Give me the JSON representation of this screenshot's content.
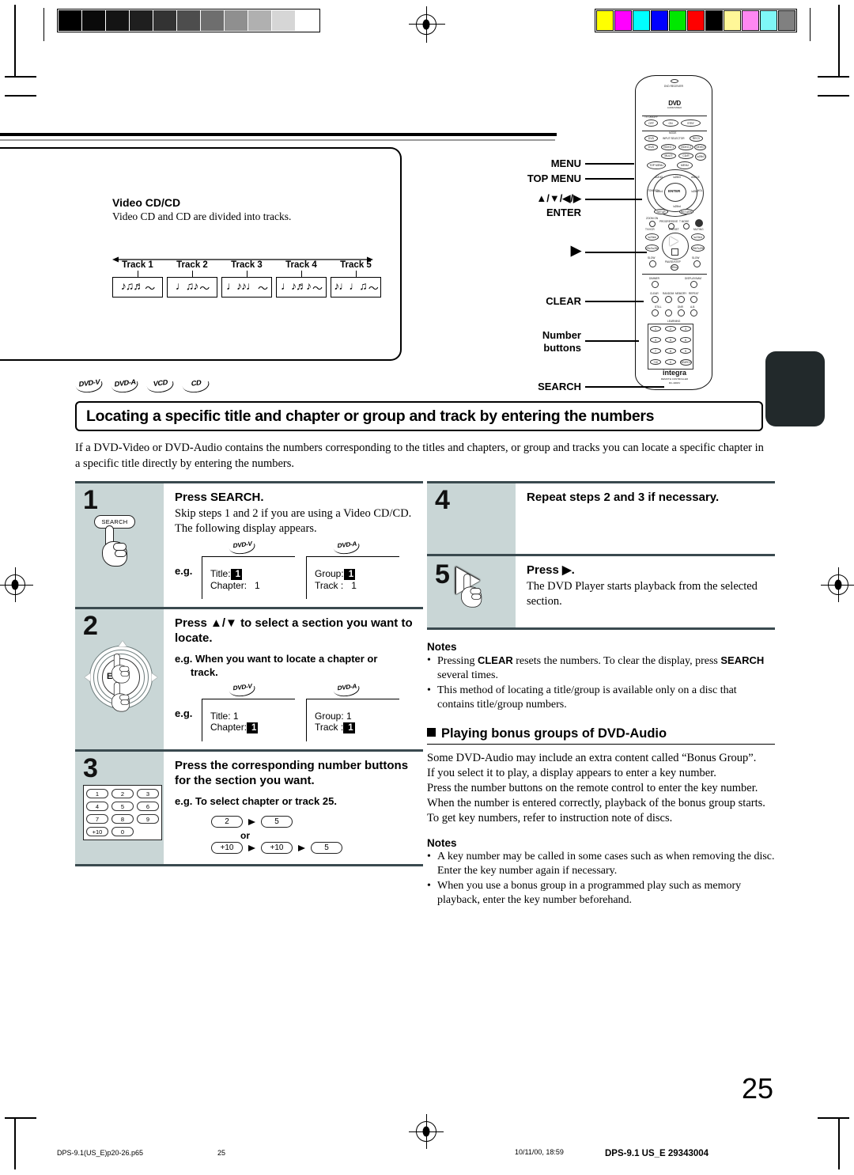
{
  "document": {
    "page_number": "25",
    "footer": {
      "file_name": "DPS-9.1(US_E)p20-26.p65",
      "page": "25",
      "timestamp": "10/11/00, 18:59",
      "model_code": "DPS-9.1 US_E   29343004"
    }
  },
  "figure": {
    "title": "Video CD/CD",
    "subtitle": "Video CD and CD are divided into tracks.",
    "tracks": [
      {
        "label": "Track 1",
        "notes": "♪♫♬"
      },
      {
        "label": "Track 2",
        "notes": "♩♫♪"
      },
      {
        "label": "Track 3",
        "notes": "♩♪♪♩"
      },
      {
        "label": "Track 4",
        "notes": "♩♪♬♪"
      },
      {
        "label": "Track 5",
        "notes": "♪♩♩♫"
      }
    ],
    "tilde": "〜"
  },
  "disc_badges": [
    "DVD-V",
    "DVD-A",
    "VCD",
    "CD"
  ],
  "heading": {
    "title": "Locating a specific title and chapter or group and track by entering the numbers",
    "intro": "If a DVD-Video or DVD-Audio contains the numbers corresponding to the titles and chapters, or group and tracks you can locate a specific chapter in a specific title directly by entering the numbers."
  },
  "remote_callouts": {
    "menu": "MENU",
    "top_menu": "TOP MENU",
    "arrows": "▲/▼/◀/▶",
    "enter": "ENTER",
    "play": "▶",
    "clear": "CLEAR",
    "number_buttons_line1": "Number",
    "number_buttons_line2": "buttons",
    "search": "SEARCH",
    "brand": "integra",
    "brand_sub1": "REMOTE CONTROLLER",
    "brand_sub2": "RC-430DV",
    "dvd_logo": "DVD",
    "dvd_logo_sub": "AUDIO/VIDEO"
  },
  "steps": [
    {
      "num": "1",
      "heading": "Press SEARCH.",
      "text": "Skip steps 1 and 2 if you are using a Video CD/CD.\nThe following display appears.",
      "button_label": "SEARCH",
      "eg_label": "e.g.",
      "displays": [
        {
          "badge": "DVD-V",
          "line1_label": "Title:",
          "line1_value": "1",
          "line1_highlight": true,
          "line2_label": "Chapter:",
          "line2_value": "1",
          "line2_highlight": false
        },
        {
          "badge": "DVD-A",
          "line1_label": "Group:",
          "line1_value": "1",
          "line1_highlight": true,
          "line2_label": "Track :",
          "line2_value": "1",
          "line2_highlight": false
        }
      ]
    },
    {
      "num": "2",
      "heading": "Press ▲/▼ to select a section you want to locate.",
      "eg_note_line1": "e.g. When you want to locate a chapter or",
      "eg_note_line2": "track.",
      "jog_label": "ENTER",
      "eg_label": "e.g.",
      "displays": [
        {
          "badge": "DVD-V",
          "line1_label": "Title:",
          "line1_value": "1",
          "line1_highlight": false,
          "line2_label": "Chapter:",
          "line2_value": "1",
          "line2_highlight": true
        },
        {
          "badge": "DVD-A",
          "line1_label": "Group:",
          "line1_value": "1",
          "line1_highlight": false,
          "line2_label": "Track :",
          "line2_value": "1",
          "line2_highlight": true
        }
      ]
    },
    {
      "num": "3",
      "heading": "Press the corresponding number buttons for the section you want.",
      "eg_note": "e.g. To select chapter or track 25.",
      "keypad": [
        [
          "1",
          "2",
          "3"
        ],
        [
          "4",
          "5",
          "6"
        ],
        [
          "7",
          "8",
          "9"
        ],
        [
          "+10",
          "0"
        ]
      ],
      "chain_row1": [
        "2",
        "5"
      ],
      "or_label": "or",
      "chain_row2": [
        "+10",
        "+10",
        "5"
      ]
    },
    {
      "num": "4",
      "heading": "Repeat steps 2 and 3 if necessary."
    },
    {
      "num": "5",
      "heading": "Press ▶.",
      "text": "The DVD Player starts playback from the selected section."
    }
  ],
  "notes_1": {
    "title": "Notes",
    "items": [
      {
        "pre": "Pressing ",
        "bold1": "CLEAR",
        "mid": " resets the numbers. To clear the display, press ",
        "bold2": "SEARCH",
        "post": " several times."
      },
      {
        "pre": "This method of locating a title/group is available only on a disc that contains title/group numbers.",
        "bold1": "",
        "mid": "",
        "bold2": "",
        "post": ""
      }
    ]
  },
  "bonus_section": {
    "title": "Playing bonus groups of DVD-Audio",
    "body": "Some DVD-Audio may include an extra content called “Bonus Group”.\nIf you select it to play, a display appears to enter a key number.\nPress the number buttons on the remote control to enter the key number.\nWhen the number is entered correctly, playback of the bonus group starts.\nTo get key numbers, refer to instruction note of discs."
  },
  "notes_2": {
    "title": "Notes",
    "items": [
      {
        "pre": "A key number may be called in some cases such as when removing the disc. Enter the key number again if necessary.",
        "bold1": "",
        "mid": "",
        "bold2": "",
        "post": ""
      },
      {
        "pre": "When you use a bonus group in a programmed play such as memory playback, enter the key number beforehand.",
        "bold1": "",
        "mid": "",
        "bold2": "",
        "post": ""
      }
    ]
  },
  "print_marks": {
    "grayscale": [
      "#000000",
      "#0a0a0a",
      "#141414",
      "#1f1f1f",
      "#333333",
      "#4d4d4d",
      "#6e6e6e",
      "#8f8f8f",
      "#b0b0b0",
      "#d6d6d6",
      "#ffffff"
    ],
    "colorbar": [
      "#ffff00",
      "#ff00ff",
      "#00ffff",
      "#0000ff",
      "#00e800",
      "#ff0000",
      "#000000",
      "#fff798",
      "#ff87f2",
      "#7ff7f7",
      "#808080"
    ]
  }
}
